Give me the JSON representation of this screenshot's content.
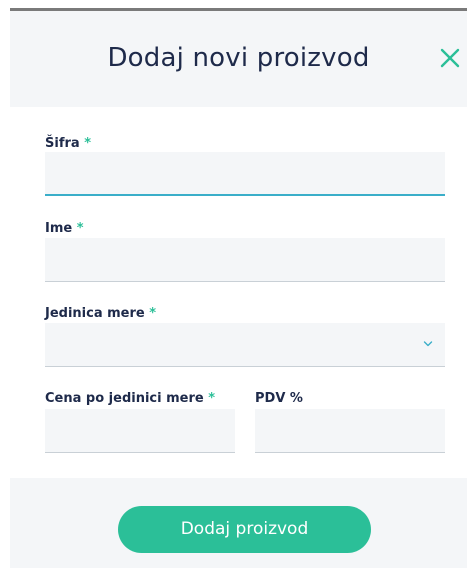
{
  "modal": {
    "title": "Dodaj novi proizvod",
    "close_icon": "close-icon",
    "accent_color": "#2bbf98"
  },
  "form": {
    "code": {
      "label": "Šifra",
      "required_mark": "*",
      "value": ""
    },
    "name": {
      "label": "Ime",
      "required_mark": "*",
      "value": ""
    },
    "unit": {
      "label": "Jedinica mere",
      "required_mark": "*",
      "selected": ""
    },
    "price": {
      "label": "Cena po jedinici mere",
      "required_mark": "*",
      "value": ""
    },
    "vat": {
      "label": "PDV %",
      "value": ""
    }
  },
  "footer": {
    "submit_label": "Dodaj proizvod"
  }
}
